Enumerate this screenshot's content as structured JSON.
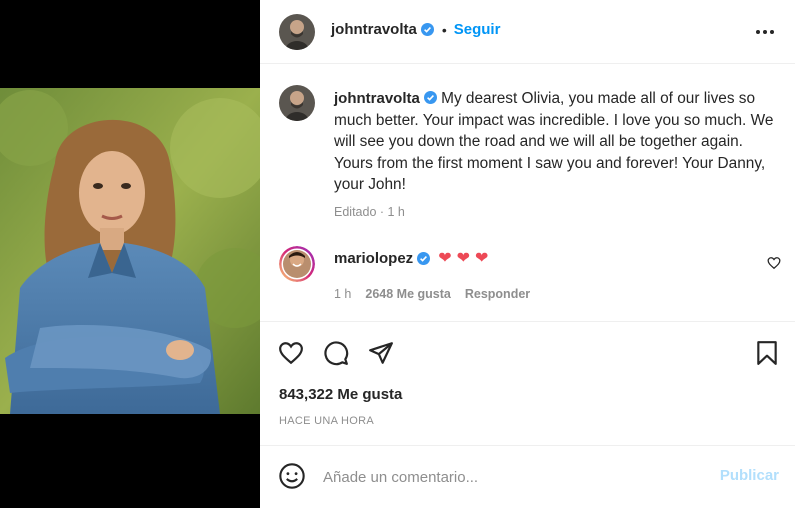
{
  "post": {
    "author": "johntravolta",
    "follow_label": "Seguir",
    "header_separator": "•",
    "caption": "My dearest Olivia, you made all of our lives so much better. Your impact was incredible. I love you so much. We will see you down the road and we will all be together again. Yours from the first moment I saw you and forever! Your Danny, your John!",
    "caption_meta": "Editado · 1 h",
    "likes": "843,322 Me gusta",
    "timestamp": "HACE UNA HORA"
  },
  "comments": [
    {
      "user": "mariolopez",
      "hearts": [
        "❤",
        "❤",
        "❤"
      ],
      "time": "1 h",
      "likes": "2648 Me gusta",
      "reply_label": "Responder"
    }
  ],
  "composer": {
    "placeholder": "Añade un comentario...",
    "post_label": "Publicar"
  },
  "icons": {
    "more": "more-options-icon",
    "like": "heart-icon",
    "comment": "comment-icon",
    "share": "share-icon",
    "save": "bookmark-icon",
    "emoji": "emoji-icon",
    "verified": "verified-badge-icon"
  },
  "colors": {
    "accent": "#0095f6",
    "verified": "#3897f0",
    "heart": "#ed4956",
    "publish_disabled": "#b2dffc"
  }
}
